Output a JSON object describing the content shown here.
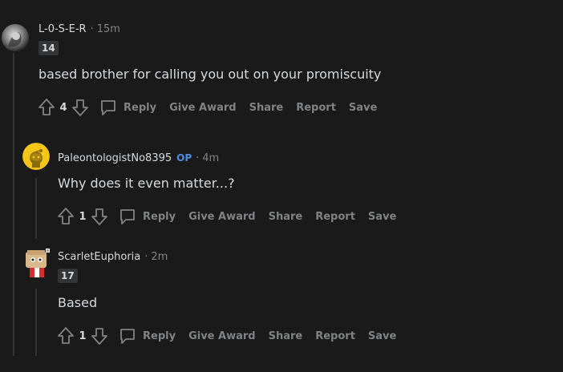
{
  "comments": [
    {
      "username": "L-0-S-E-R",
      "op_badge": "",
      "time": "15m",
      "flair": "14",
      "body": "based brother for calling you out on your promiscuity",
      "votes": "4",
      "avatar_icon": "user-avatar-icon"
    },
    {
      "username": "PaleontologistNo8395",
      "op_badge": "OP",
      "time": "4m",
      "flair": "",
      "body": "Why does it even matter...?",
      "votes": "1",
      "avatar_icon": "snoo-avatar-icon"
    },
    {
      "username": "ScarletEuphoria",
      "op_badge": "",
      "time": "2m",
      "flair": "17",
      "body": "Based",
      "votes": "1",
      "avatar_icon": "custom-avatar-icon"
    }
  ],
  "actions": {
    "reply": "Reply",
    "award": "Give Award",
    "share": "Share",
    "report": "Report",
    "save": "Save"
  },
  "meta_separator": "·",
  "colors": {
    "background": "#1a1a1b",
    "text": "#d7dadc",
    "muted": "#818384",
    "op": "#4b8fe0",
    "thread_line": "#343536"
  }
}
